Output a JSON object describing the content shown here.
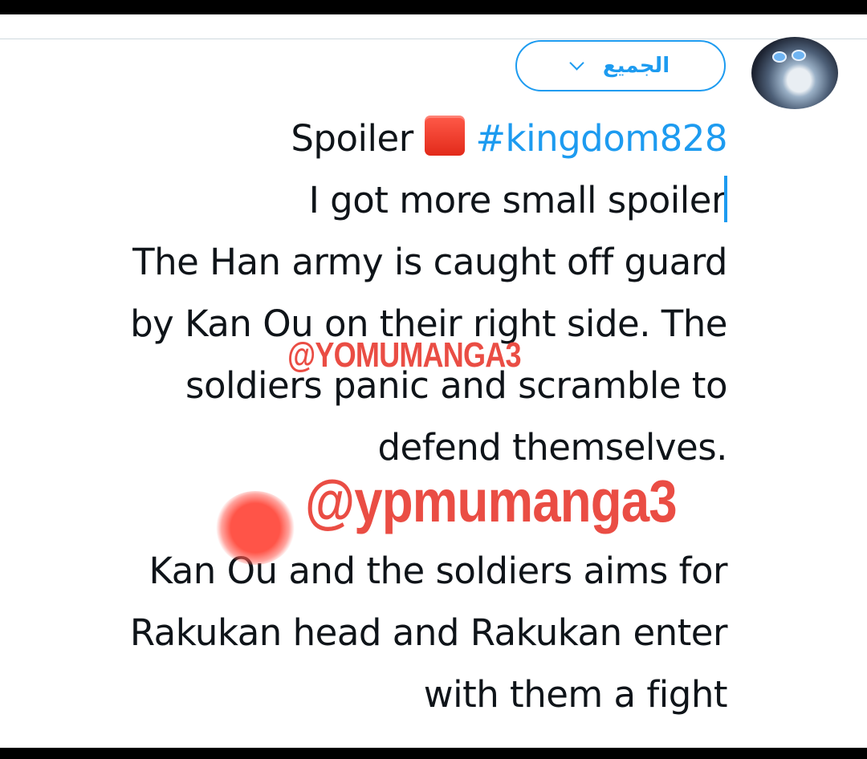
{
  "header": {
    "audience_selector": {
      "label": "الجميع",
      "icon": "chevron-down-icon"
    },
    "avatar_icon": "user-avatar"
  },
  "tweet": {
    "lines": [
      {
        "before": "Spoiler ",
        "emoji": "red-square-emoji",
        "hashtag": "#kingdom828"
      },
      "I got more  small spoiler",
      "The Han army is caught off guard",
      "by Kan Ou on their right side. The",
      "soldiers panic and scramble to",
      "defend themselves.",
      "",
      "Kan Ou and the soldiers aims for",
      "Rakukan head and Rakukan enter",
      "with them a fight"
    ]
  },
  "watermarks": {
    "top": "@YOMUMANGA3",
    "main": "@ypmumanga3"
  },
  "colors": {
    "accent": "#1d9bf0",
    "watermark": "#ea4d44",
    "text": "#0f1419"
  }
}
